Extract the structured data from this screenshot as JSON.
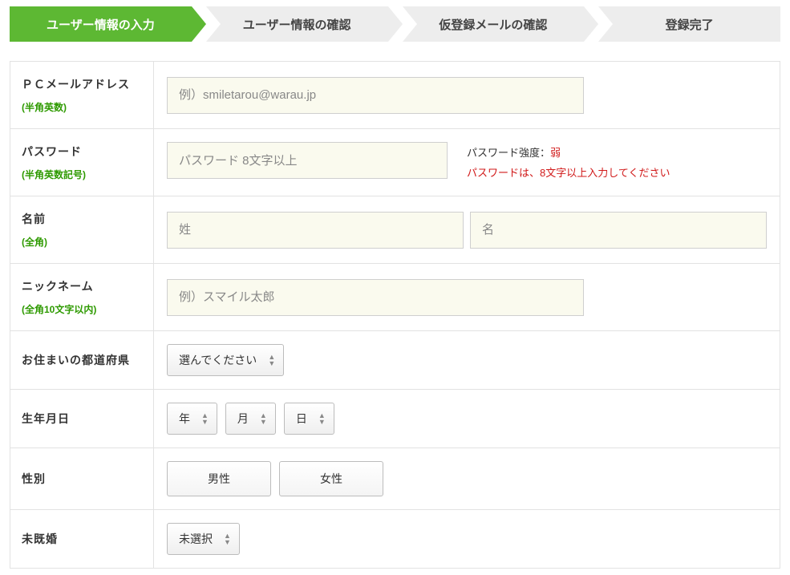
{
  "steps": {
    "s1": "ユーザー情報の入力",
    "s2": "ユーザー情報の確認",
    "s3": "仮登録メールの確認",
    "s4": "登録完了"
  },
  "rows": {
    "email": {
      "label": "ＰＣメールアドレス",
      "sub": "(半角英数)",
      "placeholder": "例）smiletarou@warau.jp"
    },
    "password": {
      "label": "パスワード",
      "sub": "(半角英数記号)",
      "placeholder": "パスワード 8文字以上",
      "strength_label": "パスワード強度：",
      "strength_value": "弱",
      "warning": "パスワードは、8文字以上入力してください"
    },
    "name": {
      "label": "名前",
      "sub": "(全角)",
      "placeholder_last": "姓",
      "placeholder_first": "名"
    },
    "nickname": {
      "label": "ニックネーム",
      "sub": "(全角10文字以内)",
      "placeholder": "例）スマイル太郎"
    },
    "prefecture": {
      "label": "お住まいの都道府県",
      "selected": "選んでください"
    },
    "birthdate": {
      "label": "生年月日",
      "year": "年",
      "month": "月",
      "day": "日"
    },
    "gender": {
      "label": "性別",
      "male": "男性",
      "female": "女性"
    },
    "marital": {
      "label": "未既婚",
      "selected": "未選択"
    }
  }
}
